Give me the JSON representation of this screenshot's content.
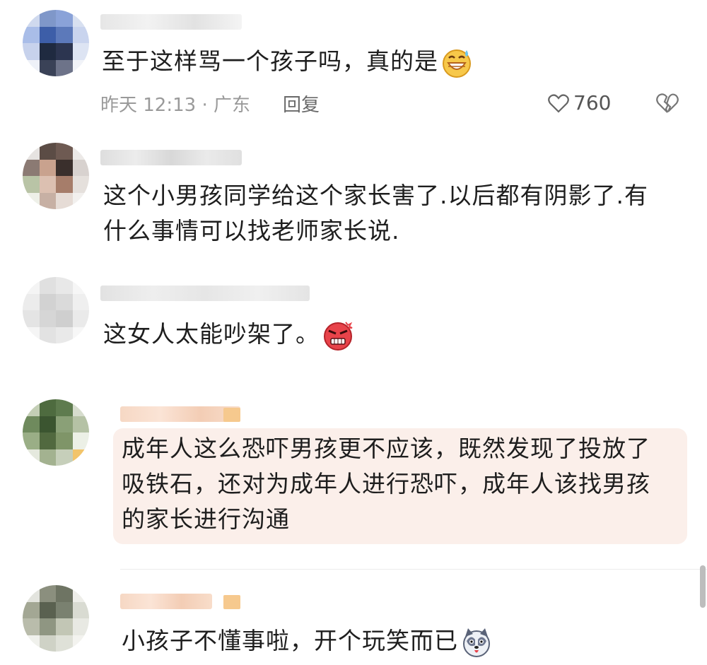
{
  "comments": [
    {
      "text_lines": [
        "至于这样骂一个孩子吗，真的是"
      ],
      "emoji": "grinning-sweat-emoji",
      "meta": "昨天 12:13 · 广东",
      "reply_label": "回复",
      "like_count": "760"
    },
    {
      "text_lines": [
        "这个小男孩同学给这个家长害了.以后都有阴影了.有",
        "什么事情可以找老师家长说."
      ]
    },
    {
      "text_lines": [
        "这女人太能吵架了。"
      ],
      "emoji": "angry-face-emoji"
    },
    {
      "text_lines": [
        "成年人这么恐吓男孩更不应该，既然发现了投放了",
        "吸铁石，还对为成年人进行恐吓，成年人该找男孩",
        "的家长进行沟通"
      ],
      "highlighted": true
    },
    {
      "text_lines": [
        "小孩子不懂事啦，开个玩笑而已"
      ],
      "emoji": "husky-dog-emoji"
    }
  ],
  "colors": {
    "highlight_bg": "#fbefea",
    "meta_text": "#9a9a9a",
    "body_text": "#1e1e1e"
  }
}
